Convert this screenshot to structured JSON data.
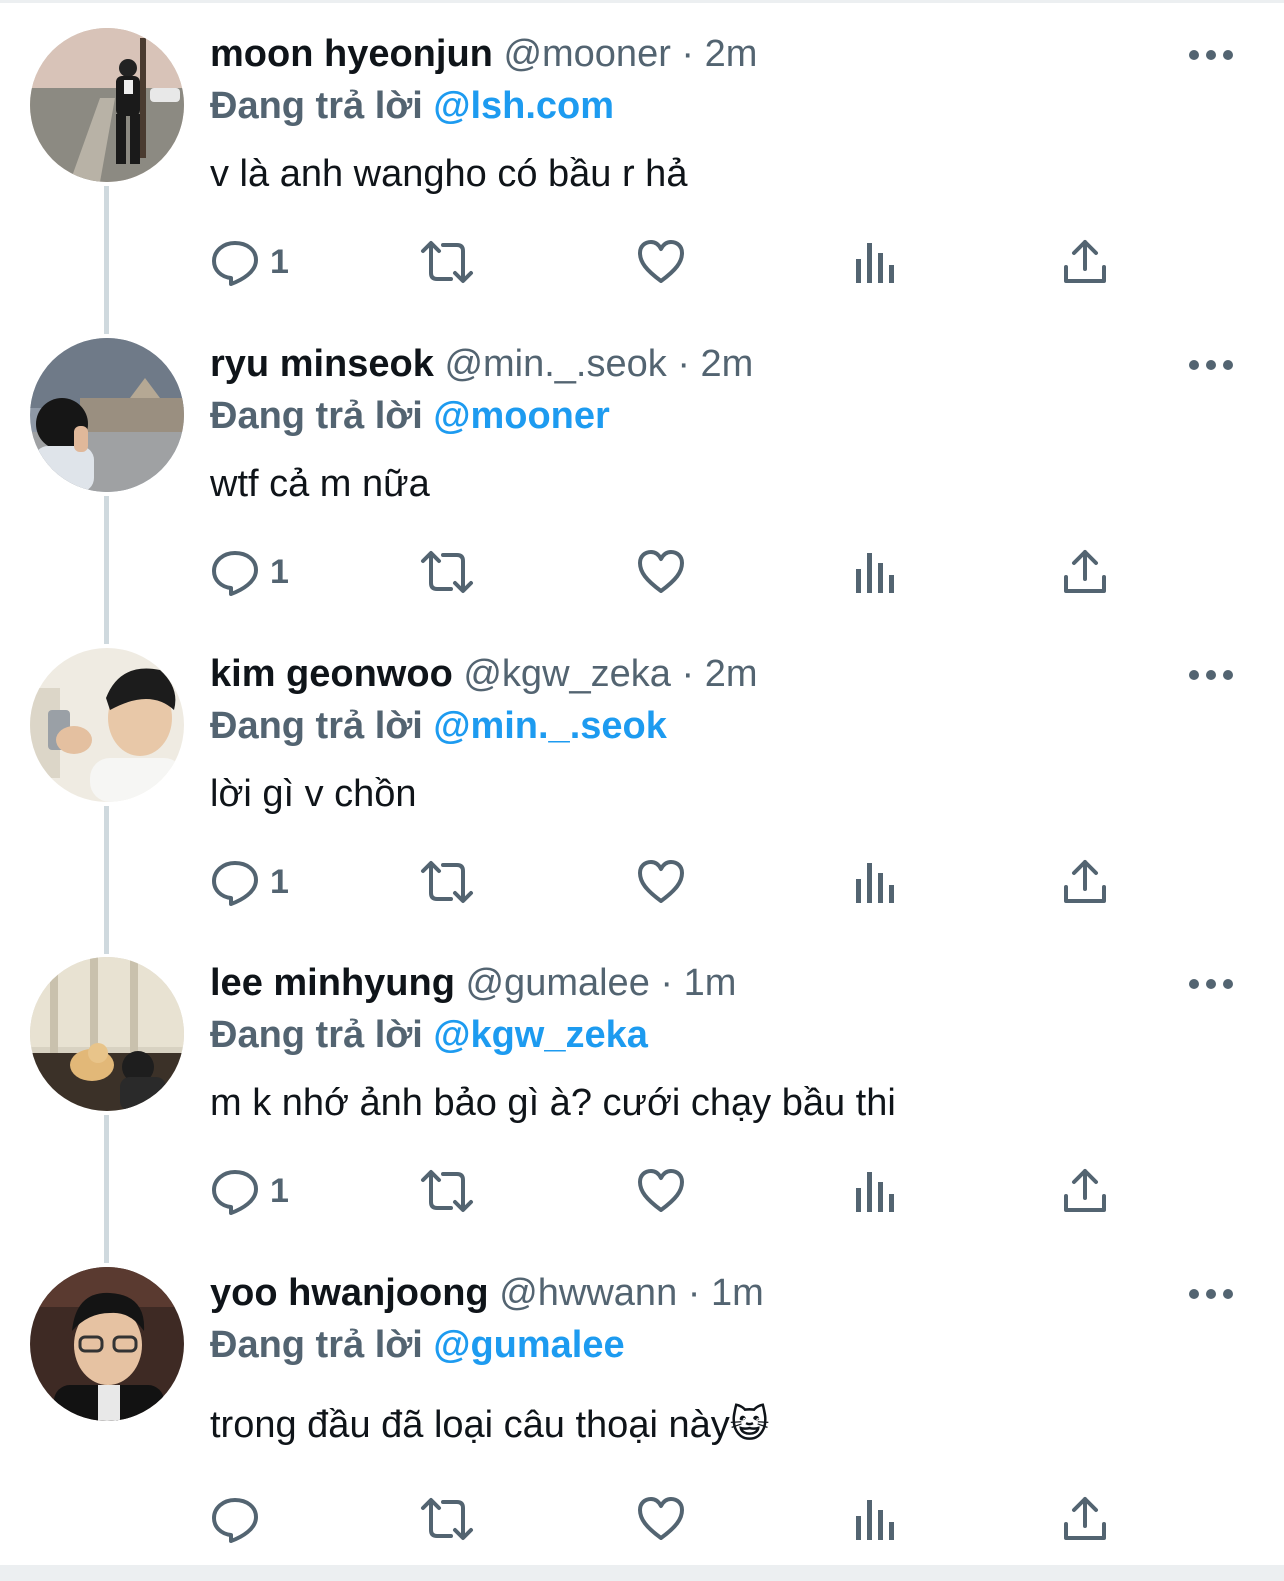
{
  "labels": {
    "reply_prefix": "Đang trả lời"
  },
  "icons": {
    "reply": "speech-bubble-icon",
    "retweet": "retweet-icon",
    "like": "heart-icon",
    "views": "bar-chart-icon",
    "share": "share-icon",
    "more": "more-dots-icon"
  },
  "colors": {
    "link": "#1d9bf0",
    "secondary": "#536471",
    "text": "#0f1419",
    "thread_line": "#cfd9de"
  },
  "tweets": [
    {
      "name": "moon hyeonjun",
      "handle": "@mooner",
      "time": "2m",
      "reply_to": "@lsh.com",
      "text": "v là anh wangho có bầu r hả",
      "reply_count": "1"
    },
    {
      "name": "ryu minseok",
      "handle": "@min._.seok",
      "time": "2m",
      "reply_to": "@mooner",
      "text": "wtf cả m nữa",
      "reply_count": "1"
    },
    {
      "name": "kim geonwoo",
      "handle": "@kgw_zeka",
      "time": "2m",
      "reply_to": "@min._.seok",
      "text": "lời gì v chồn",
      "reply_count": "1"
    },
    {
      "name": "lee minhyung",
      "handle": "@gumalee",
      "time": "1m",
      "reply_to": "@kgw_zeka",
      "text": "m k nhớ ảnh bảo gì à? cưới chạy bầu thi",
      "reply_count": "1"
    },
    {
      "name": "yoo hwanjoong",
      "handle": "@hwwann",
      "time": "1m",
      "reply_to": "@gumalee",
      "text": "trong đầu đã loại câu thoại này😺",
      "reply_count": ""
    }
  ]
}
